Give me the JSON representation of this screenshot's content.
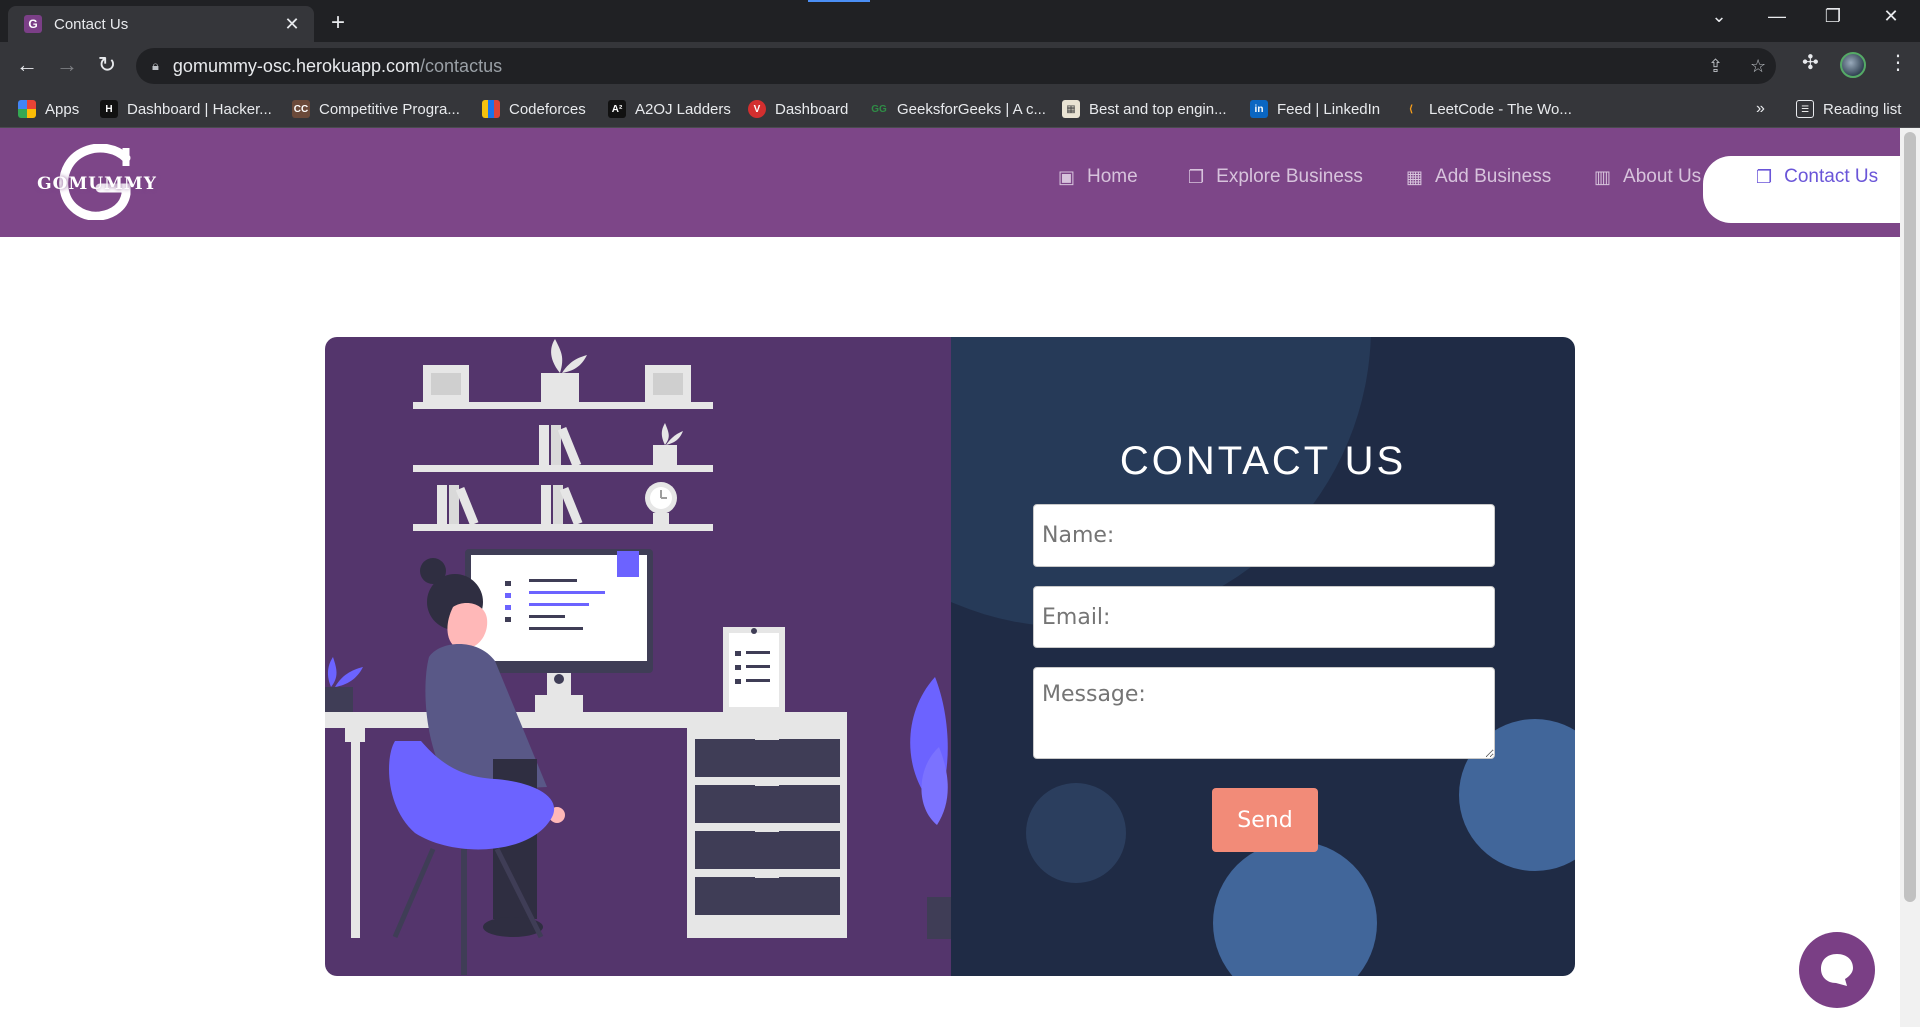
{
  "browser": {
    "tab_title": "Contact Us",
    "tab_favicon_letter": "G",
    "url_host": "gomummy-osc.herokuapp.com",
    "url_path": "/contactus",
    "bookmarks": [
      {
        "label": "Apps",
        "icon": "apps-grid-icon"
      },
      {
        "label": "Dashboard | Hacker...",
        "icon": "hackerrank-icon"
      },
      {
        "label": "Competitive Progra...",
        "icon": "codechef-icon"
      },
      {
        "label": "Codeforces",
        "icon": "codeforces-icon"
      },
      {
        "label": "A2OJ Ladders",
        "icon": "a2oj-icon"
      },
      {
        "label": "Dashboard",
        "icon": "dashboard-icon"
      },
      {
        "label": "GeeksforGeeks | A c...",
        "icon": "geeksforgeeks-icon"
      },
      {
        "label": "Best and top engin...",
        "icon": "college-icon"
      },
      {
        "label": "Feed | LinkedIn",
        "icon": "linkedin-icon"
      },
      {
        "label": "LeetCode - The Wo...",
        "icon": "leetcode-icon"
      }
    ],
    "bookmarks_more": "»",
    "reading_list": "Reading list"
  },
  "site": {
    "logo_text": "GOMUMMY",
    "logo_letter": "G",
    "nav": {
      "home": "Home",
      "explore": "Explore Business",
      "add": "Add Business",
      "about": "About Us",
      "contact": "Contact Us"
    }
  },
  "contact_form": {
    "title": "CONTACT US",
    "name_placeholder": "Name:",
    "email_placeholder": "Email:",
    "message_placeholder": "Message:",
    "send_label": "Send"
  },
  "colors": {
    "navbar": "#7d4688",
    "card_left": "#54356c",
    "card_right": "#1f2b45",
    "send_button": "#f28b78",
    "active_nav_text": "#6a55d8"
  }
}
